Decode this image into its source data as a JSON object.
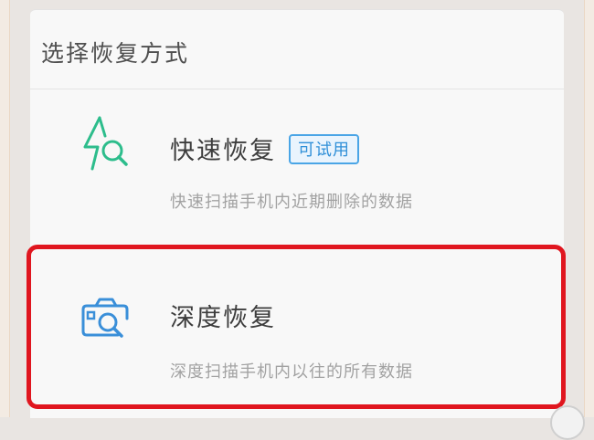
{
  "section": {
    "title": "选择恢复方式"
  },
  "options": [
    {
      "name": "快速恢复",
      "badge": "可试用",
      "description": "快速扫描手机内近期删除的数据",
      "icon": "lightning-search-icon",
      "icon_color": "#2dbd8c"
    },
    {
      "name": "深度恢复",
      "description": "深度扫描手机内以往的所有数据",
      "icon": "camera-search-icon",
      "icon_color": "#3a8fd9"
    }
  ],
  "colors": {
    "highlight": "#e0161f",
    "badge_border": "#4aa5e6",
    "badge_text": "#2f8fd8"
  }
}
